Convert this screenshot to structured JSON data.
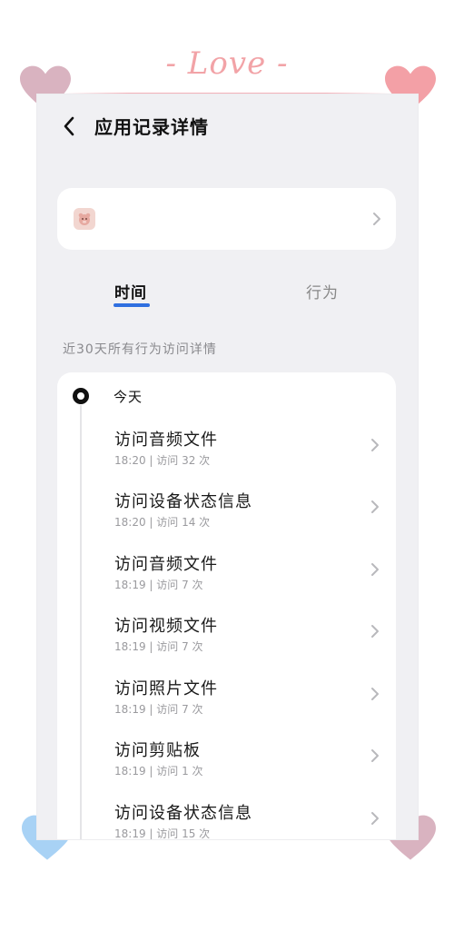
{
  "decoration": {
    "love_text": "- Love -"
  },
  "header": {
    "title": "应用记录详情"
  },
  "tabs": [
    {
      "label": "时间",
      "active": true
    },
    {
      "label": "行为",
      "active": false
    }
  ],
  "section": {
    "caption": "近30天所有行为访问详情"
  },
  "timeline": {
    "day": "今天",
    "records": [
      {
        "title": "访问音频文件",
        "meta": "18:20 | 访问 32 次"
      },
      {
        "title": "访问设备状态信息",
        "meta": "18:20 | 访问 14 次"
      },
      {
        "title": "访问音频文件",
        "meta": "18:19 | 访问 7 次"
      },
      {
        "title": "访问视频文件",
        "meta": "18:19 | 访问 7 次"
      },
      {
        "title": "访问照片文件",
        "meta": "18:19 | 访问 7 次"
      },
      {
        "title": "访问剪贴板",
        "meta": "18:19 | 访问 1 次"
      },
      {
        "title": "访问设备状态信息",
        "meta": "18:19 | 访问 15 次"
      }
    ]
  },
  "colors": {
    "accent": "#2f6fe0",
    "screen_bg": "#f0f0f3",
    "heart_pink": "#f3a0a6",
    "heart_mauve": "#d9b3c0",
    "heart_blue": "#a8d2f5"
  },
  "icons": {
    "back": "chevron-left-icon",
    "row": "chevron-right-icon",
    "app": "app-icon"
  }
}
